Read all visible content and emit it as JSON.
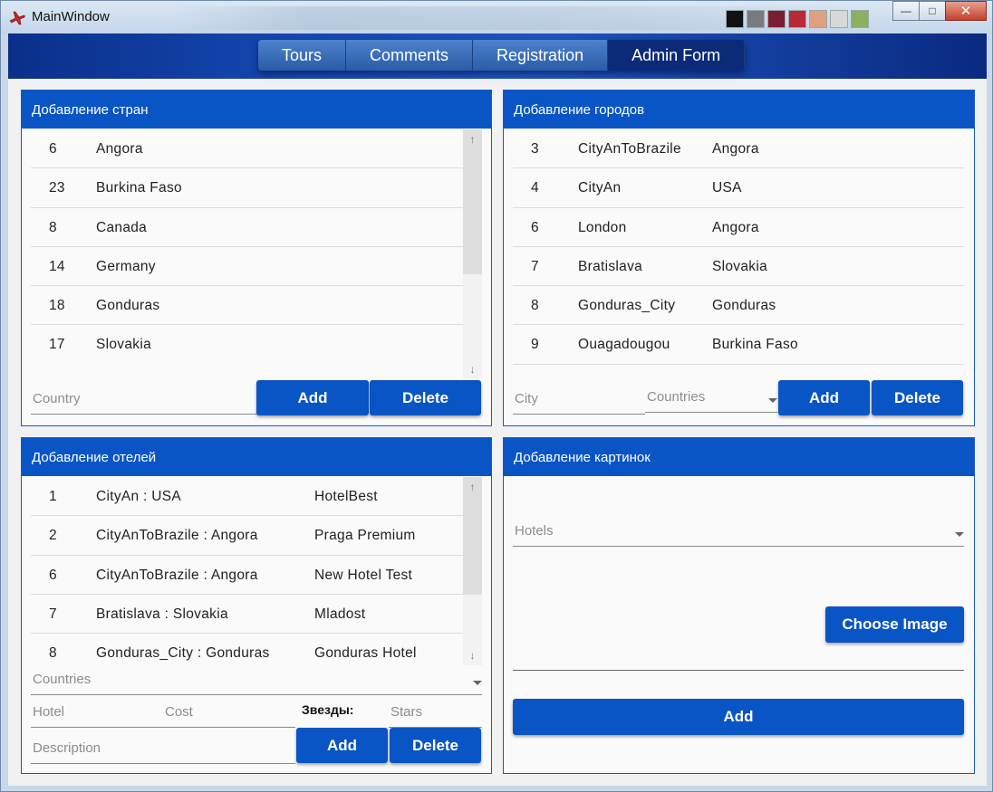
{
  "window": {
    "title": "MainWindow",
    "swatch_colors": [
      "#111111",
      "#777b80",
      "#7a1f2f",
      "#b82a3a",
      "#e0a080",
      "#d8d8d8",
      "#8ab060"
    ]
  },
  "nav": {
    "tabs": [
      "Tours",
      "Comments",
      "Registration",
      "Admin Form"
    ],
    "active": "Admin Form"
  },
  "countries_panel": {
    "title": "Добавление стран",
    "rows": [
      {
        "id": "6",
        "name": "Angora"
      },
      {
        "id": "23",
        "name": "Burkina Faso"
      },
      {
        "id": "8",
        "name": "Canada"
      },
      {
        "id": "14",
        "name": "Germany"
      },
      {
        "id": "18",
        "name": "Gonduras"
      },
      {
        "id": "17",
        "name": "Slovakia"
      }
    ],
    "country_placeholder": "Country",
    "add_label": "Add",
    "delete_label": "Delete"
  },
  "cities_panel": {
    "title": "Добавление городов",
    "rows": [
      {
        "id": "3",
        "city": "CityAnToBrazile",
        "country": "Angora"
      },
      {
        "id": "4",
        "city": "CityAn",
        "country": "USA"
      },
      {
        "id": "6",
        "city": "London",
        "country": "Angora"
      },
      {
        "id": "7",
        "city": "Bratislava",
        "country": "Slovakia"
      },
      {
        "id": "8",
        "city": "Gonduras_City",
        "country": "Gonduras"
      },
      {
        "id": "9",
        "city": "Ouagadougou",
        "country": "Burkina Faso"
      }
    ],
    "city_placeholder": "City",
    "countries_placeholder": "Countries",
    "add_label": "Add",
    "delete_label": "Delete"
  },
  "hotels_panel": {
    "title": "Добавление отелей",
    "rows": [
      {
        "id": "1",
        "location": "CityAn : USA",
        "hotel": "HotelBest"
      },
      {
        "id": "2",
        "location": "CityAnToBrazile : Angora",
        "hotel": "Praga Premium"
      },
      {
        "id": "6",
        "location": "CityAnToBrazile : Angora",
        "hotel": "New Hotel Test"
      },
      {
        "id": "7",
        "location": "Bratislava : Slovakia",
        "hotel": "Mladost"
      },
      {
        "id": "8",
        "location": "Gonduras_City : Gonduras",
        "hotel": "Gonduras Hotel"
      }
    ],
    "countries_placeholder": "Countries",
    "hotel_placeholder": "Hotel",
    "cost_placeholder": "Cost",
    "stars_label": "Звезды:",
    "stars_placeholder": "Stars",
    "description_placeholder": "Description",
    "add_label": "Add",
    "delete_label": "Delete"
  },
  "images_panel": {
    "title": "Добавление картинок",
    "hotels_placeholder": "Hotels",
    "choose_label": "Choose Image",
    "add_label": "Add"
  }
}
